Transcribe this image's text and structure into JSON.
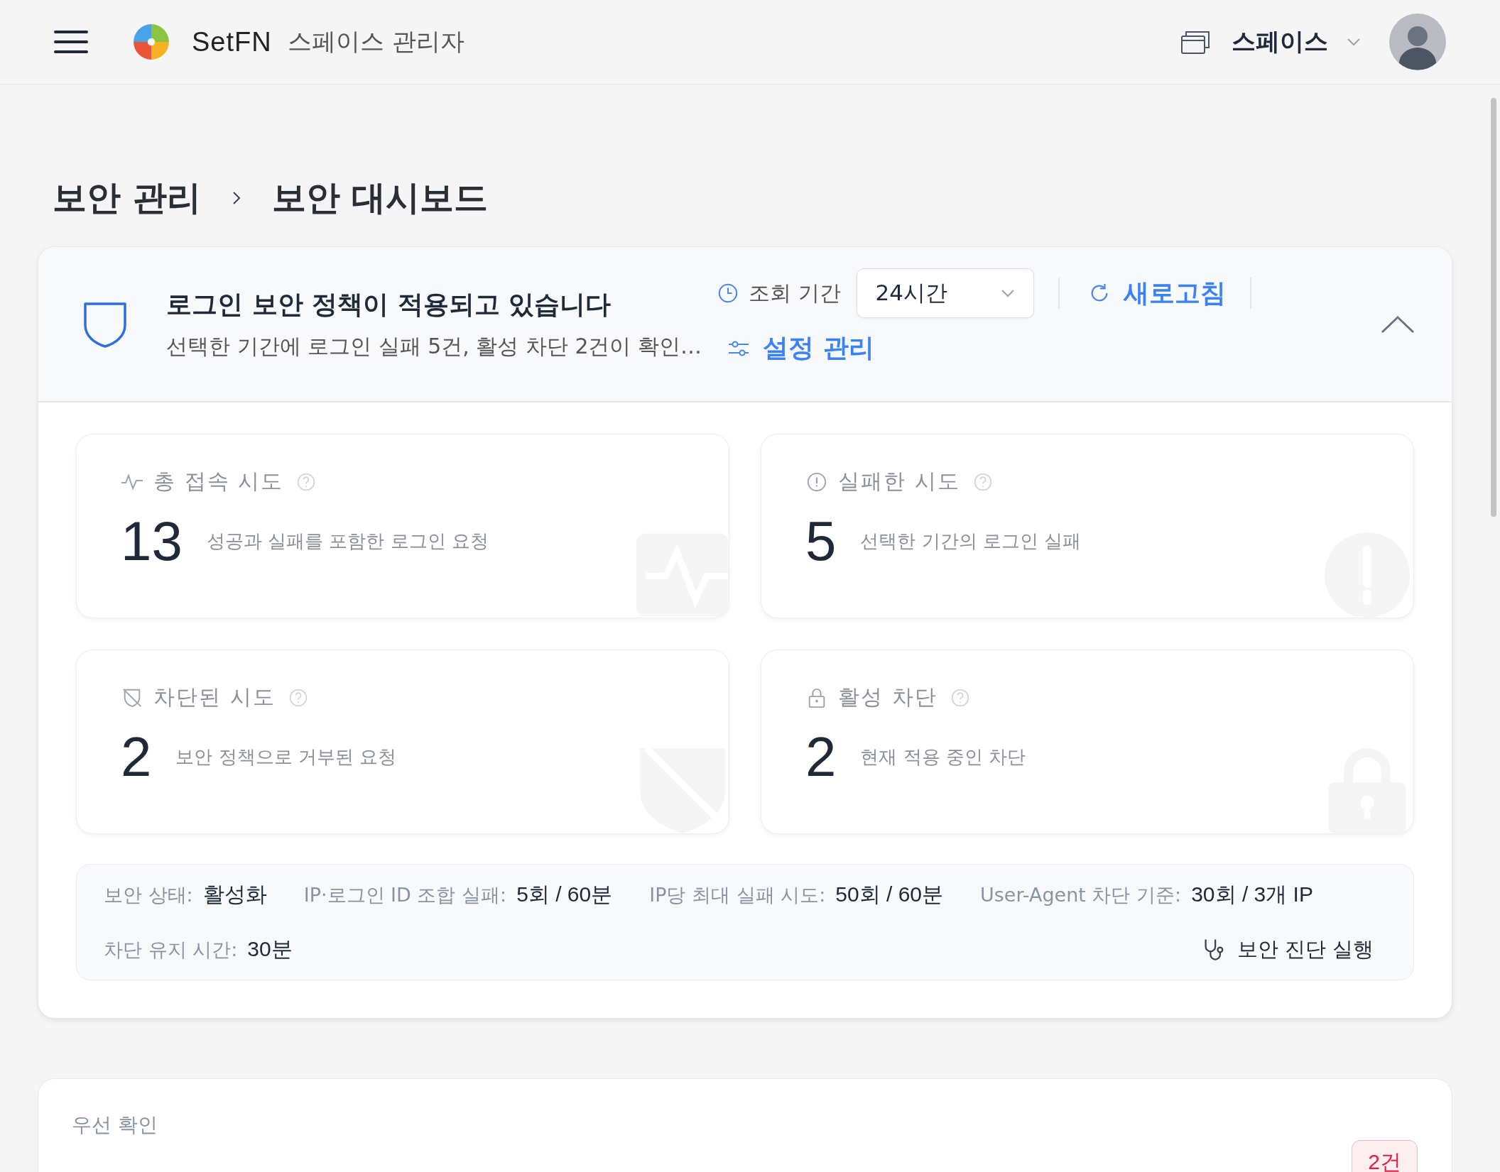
{
  "header": {
    "app_name": "SetFN",
    "app_subtitle": "스페이스 관리자",
    "space_label": "스페이스"
  },
  "breadcrumb": [
    {
      "label": "보안 관리"
    },
    {
      "label": "보안 대시보드"
    }
  ],
  "policy": {
    "title": "로그인 보안 정책이 적용되고 있습니다",
    "summary": "선택한 기간에 로그인 실패 5건, 활성 차단 2건이 확인…",
    "period_label": "조회 기간",
    "period_value": "24시간",
    "refresh": "새로고침",
    "settings": "설정 관리",
    "expanded": true
  },
  "stats": [
    {
      "kind": "activity",
      "title": "총 접속 시도",
      "value": "13",
      "caption": "성공과 실패를 포함한 로그인 요청"
    },
    {
      "kind": "alert",
      "title": "실패한 시도",
      "value": "5",
      "caption": "선택한 기간의 로그인 실패"
    },
    {
      "kind": "blocked",
      "title": "차단된 시도",
      "value": "2",
      "caption": "보안 정책으로 거부된 요청"
    },
    {
      "kind": "lock",
      "title": "활성 차단",
      "value": "2",
      "caption": "현재 적용 중인 차단"
    }
  ],
  "policy_info": [
    {
      "label": "보안 상태:",
      "value": "활성화"
    },
    {
      "label": "IP·로그인 ID 조합 실패:",
      "value": "5회 / 60분"
    },
    {
      "label": "IP당 최대 실패 시도:",
      "value": "50회 / 60분"
    },
    {
      "label": "User-Agent 차단 기준:",
      "value": "30회 / 3개 IP"
    },
    {
      "label": "차단 유지 시간:",
      "value": "30분"
    }
  ],
  "diagnose_button": "보안 진단 실행",
  "priority": {
    "title": "우선 확인",
    "badge": "2건"
  }
}
